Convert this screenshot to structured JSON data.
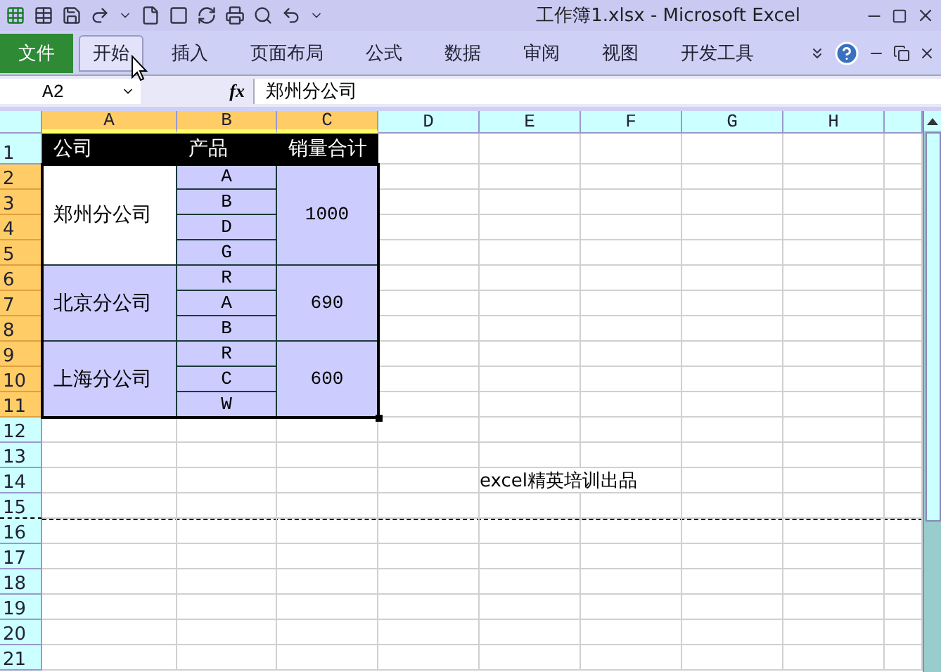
{
  "window": {
    "title": "工作簿1.xlsx  -  Microsoft Excel"
  },
  "file_tab": "文件",
  "tabs": [
    {
      "label": "开始",
      "selected": true
    },
    {
      "label": "插入",
      "selected": false
    },
    {
      "label": "页面布局",
      "selected": false
    },
    {
      "label": "公式",
      "selected": false
    },
    {
      "label": "数据",
      "selected": false
    },
    {
      "label": "审阅",
      "selected": false
    },
    {
      "label": "视图",
      "selected": false
    },
    {
      "label": "开发工具",
      "selected": false
    }
  ],
  "formula_bar": {
    "name_box": "A2",
    "fx": "fx",
    "value": "郑州分公司"
  },
  "columns": [
    {
      "label": "A",
      "selected": true
    },
    {
      "label": "B",
      "selected": true
    },
    {
      "label": "C",
      "selected": true
    },
    {
      "label": "D",
      "selected": false
    },
    {
      "label": "E",
      "selected": false
    },
    {
      "label": "F",
      "selected": false
    },
    {
      "label": "G",
      "selected": false
    },
    {
      "label": "H",
      "selected": false
    }
  ],
  "rows": [
    {
      "label": "1",
      "selected": false,
      "page_break": false
    },
    {
      "label": "2",
      "selected": true,
      "page_break": false
    },
    {
      "label": "3",
      "selected": true,
      "page_break": false
    },
    {
      "label": "4",
      "selected": true,
      "page_break": false
    },
    {
      "label": "5",
      "selected": true,
      "page_break": false
    },
    {
      "label": "6",
      "selected": true,
      "page_break": false
    },
    {
      "label": "7",
      "selected": true,
      "page_break": false
    },
    {
      "label": "8",
      "selected": true,
      "page_break": false
    },
    {
      "label": "9",
      "selected": true,
      "page_break": false
    },
    {
      "label": "10",
      "selected": true,
      "page_break": false
    },
    {
      "label": "11",
      "selected": true,
      "page_break": false
    },
    {
      "label": "12",
      "selected": false,
      "page_break": false
    },
    {
      "label": "13",
      "selected": false,
      "page_break": false
    },
    {
      "label": "14",
      "selected": false,
      "page_break": false,
      "cells": [
        null,
        null,
        null,
        null,
        "excel精英培训出品"
      ]
    },
    {
      "label": "15",
      "selected": false,
      "page_break": true
    },
    {
      "label": "16",
      "selected": false,
      "page_break": false
    },
    {
      "label": "17",
      "selected": false,
      "page_break": false
    },
    {
      "label": "18",
      "selected": false,
      "page_break": false
    },
    {
      "label": "19",
      "selected": false,
      "page_break": false
    },
    {
      "label": "20",
      "selected": false,
      "page_break": false
    },
    {
      "label": "21",
      "selected": false,
      "page_break": false
    }
  ],
  "table": {
    "header": [
      "公司",
      "产品",
      "销量合计"
    ],
    "groups": [
      {
        "company": "郑州分公司",
        "active": true,
        "products": [
          "A",
          "B",
          "D",
          "G"
        ],
        "total": "1000"
      },
      {
        "company": "北京分公司",
        "active": false,
        "products": [
          "R",
          "A",
          "B"
        ],
        "total": "690"
      },
      {
        "company": "上海分公司",
        "active": false,
        "products": [
          "R",
          "C",
          "W"
        ],
        "total": "600"
      }
    ]
  }
}
